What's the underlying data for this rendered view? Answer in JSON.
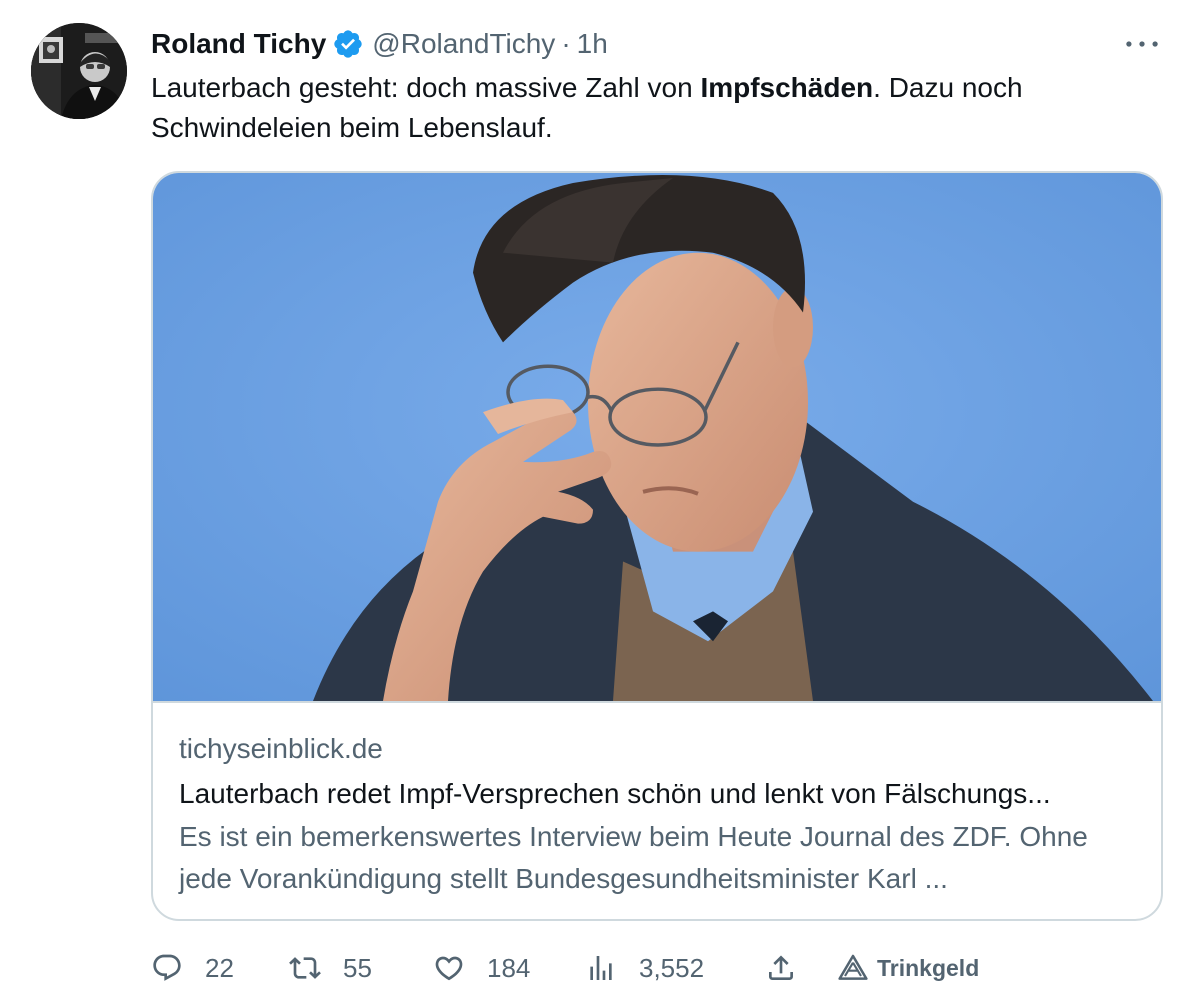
{
  "tweet": {
    "display_name": "Roland Tichy",
    "handle": "@RolandTichy",
    "separator": "·",
    "time": "1h",
    "text_before": "Lauterbach gesteht: doch massive Zahl von ",
    "text_bold": "Impfschäden",
    "text_after": ".  Dazu noch Schwindeleien beim Lebenslauf."
  },
  "card": {
    "domain": "tichyseinblick.de",
    "title": "Lauterbach redet Impf-Versprechen schön und lenkt von Fälschungs...",
    "description": "Es ist ein bemerkenswertes Interview beim Heute Journal des ZDF. Ohne jede Vorankündigung stellt Bundesgesundheitsminister Karl ..."
  },
  "actions": {
    "replies": "22",
    "retweets": "55",
    "likes": "184",
    "views": "3,552",
    "tip_label": "Trinkgeld"
  },
  "icons": {
    "verified": "verified-badge-icon",
    "more": "more-options-icon",
    "reply": "reply-icon",
    "retweet": "retweet-icon",
    "like": "heart-icon",
    "views": "views-chart-icon",
    "share": "share-icon",
    "tip": "tip-icon"
  },
  "colors": {
    "text_primary": "#0f1419",
    "text_secondary": "#536471",
    "verified_blue": "#1d9bf0",
    "card_border": "#cfd9de",
    "photo_background": "#6a9fdf"
  }
}
